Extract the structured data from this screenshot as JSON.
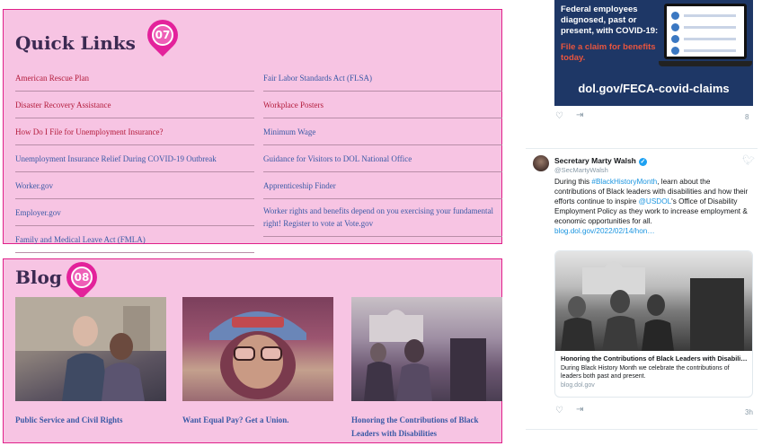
{
  "quick_links": {
    "title": "Quick Links",
    "marker": "07",
    "left": [
      "American Rescue Plan",
      "Disaster Recovery Assistance",
      "How Do I File for Unemployment Insurance?",
      "Unemployment Insurance Relief During COVID-19 Outbreak",
      "Worker.gov",
      "Employer.gov",
      "Family and Medical Leave Act (FMLA)"
    ],
    "right": [
      "Fair Labor Standards Act (FLSA)",
      "Workplace Posters",
      "Minimum Wage",
      "Guidance for Visitors to DOL National Office",
      "Apprenticeship Finder",
      "Worker rights and benefits depend on you exercising your fundamental right! Register to vote at Vote.gov"
    ]
  },
  "blog": {
    "title": "Blog",
    "marker": "08",
    "posts": [
      "Public Service and Civil Rights",
      "Want Equal Pay? Get a Union.",
      "Honoring the Contributions of Black Leaders with Disabilities"
    ]
  },
  "promo": {
    "line1": "Federal employees diagnosed, past or present, with COVID-19:",
    "line2": "File a claim for benefits today.",
    "url": "dol.gov/FECA-covid-claims"
  },
  "tweet_top": {
    "count": "8"
  },
  "tweet": {
    "name": "Secretary Marty Walsh",
    "handle": "@SecMartyWalsh",
    "body_pre": "During this ",
    "hashtag": "#BlackHistoryMonth",
    "body_mid": ", learn about the contributions of Black leaders with disabilities and how their efforts continue to inspire ",
    "mention": "@USDOL",
    "body_post": "'s Office of Disability Employment Policy as they work to increase employment & economic opportunities for all.",
    "link": "blog.dol.gov/2022/02/14/hon…",
    "card_title": "Honoring the Contributions of Black Leaders with Disabili…",
    "card_desc": "During Black History Month we celebrate the contributions of leaders both past and present.",
    "card_domain": "blog.dol.gov",
    "time": "3h"
  },
  "colors": {
    "highlight_fill": "#f7c4e3",
    "highlight_border": "#e0208a",
    "marker": "#e3229b",
    "link_red": "#b31b3b",
    "link_blue": "#3a5aa6",
    "promo_bg": "#1e3766",
    "twitter_blue": "#1da1f2"
  },
  "icons": [
    "heart-icon",
    "share-icon",
    "verified-icon",
    "twitter-bird-icon",
    "checkmark-icon"
  ]
}
